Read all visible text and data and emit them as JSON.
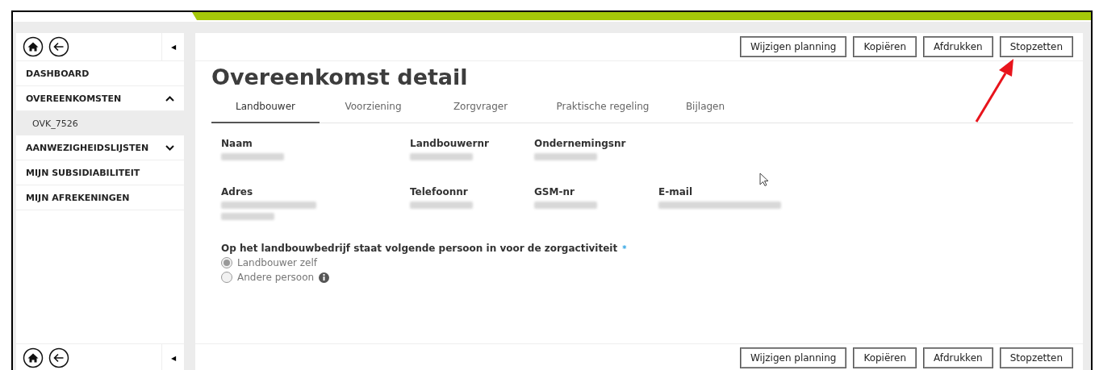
{
  "sidebar": {
    "collapse_icon": "◀",
    "items": [
      {
        "label": "DASHBOARD",
        "selected": false
      },
      {
        "label": "OVEREENKOMSTEN",
        "selected": false,
        "expanded": true,
        "children": [
          {
            "label": "OVK_7526",
            "selected": true
          }
        ]
      },
      {
        "label": "AANWEZIGHEIDSLIJSTEN",
        "selected": false,
        "expanded": false
      },
      {
        "label": "MIJN SUBSIDIABILITEIT",
        "selected": false
      },
      {
        "label": "MIJN AFREKENINGEN",
        "selected": false
      }
    ]
  },
  "toolbar": {
    "buttons": [
      "Wijzigen planning",
      "Kopiëren",
      "Afdrukken",
      "Stopzetten"
    ]
  },
  "title": "Overeenkomst detail",
  "tabs": [
    {
      "label": "Landbouwer",
      "selected": true
    },
    {
      "label": "Voorziening",
      "selected": false
    },
    {
      "label": "Zorgvrager",
      "selected": false
    },
    {
      "label": "Praktische regeling",
      "selected": false
    },
    {
      "label": "Bijlagen",
      "selected": false
    }
  ],
  "field_rows": [
    [
      {
        "label": "Naam",
        "kind": "single"
      },
      {
        "label": "Landbouwernr",
        "kind": "single"
      },
      {
        "label": "Ondernemingsnr",
        "kind": "single"
      }
    ],
    [
      {
        "label": "Adres",
        "kind": "double"
      },
      {
        "label": "Telefoonnr",
        "kind": "single"
      },
      {
        "label": "GSM-nr",
        "kind": "single"
      },
      {
        "label": "E-mail",
        "kind": "wide"
      }
    ]
  ],
  "question": {
    "label": "Op het landbouwbedrijf staat volgende persoon in voor de zorgactiviteit",
    "required_mark": "*",
    "disabled": true,
    "options": [
      {
        "label": "Landbouwer zelf",
        "selected": true,
        "info": false
      },
      {
        "label": "Andere persoon",
        "selected": false,
        "info": true
      }
    ]
  },
  "bottom_toolbar": {
    "buttons": [
      "Wijzigen planning",
      "Kopiëren",
      "Afdrukken",
      "Stopzetten"
    ]
  },
  "annotation": {
    "kind": "arrow"
  }
}
